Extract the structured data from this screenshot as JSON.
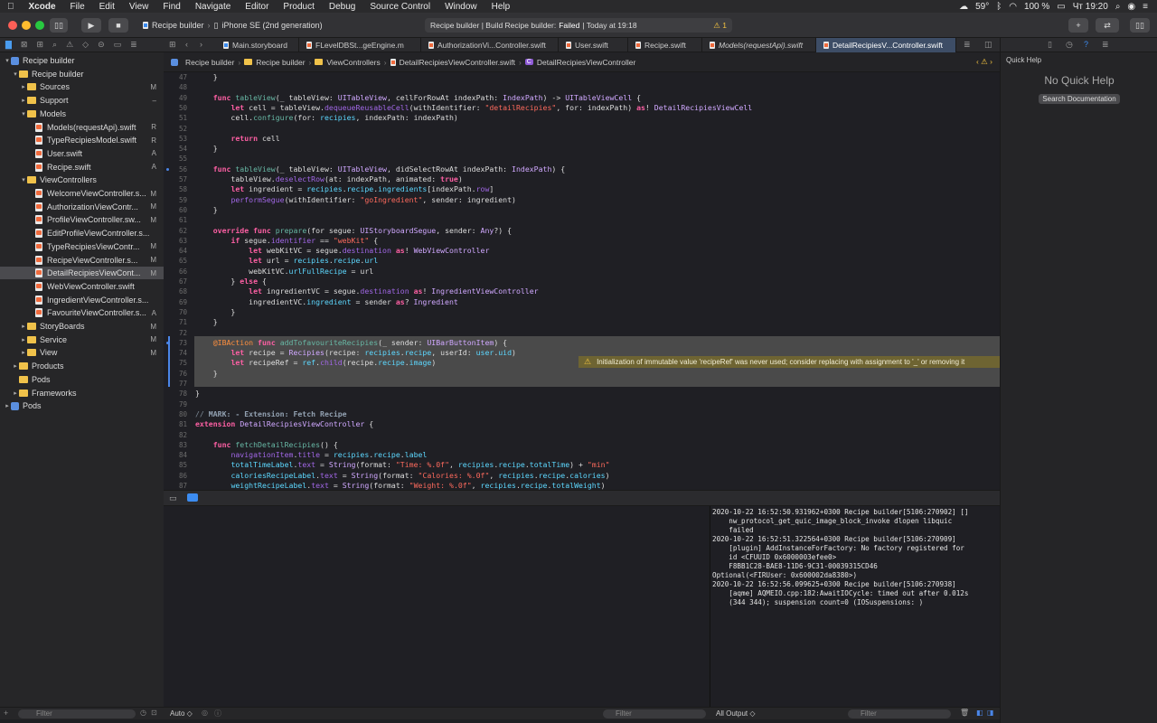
{
  "menubar": {
    "app": "Xcode",
    "items": [
      "File",
      "Edit",
      "View",
      "Find",
      "Navigate",
      "Editor",
      "Product",
      "Debug",
      "Source Control",
      "Window",
      "Help"
    ],
    "status": {
      "temperature": "59°",
      "battery": "100 %",
      "clock": "Чт 19:20"
    }
  },
  "toolbar": {
    "scheme": "Recipe builder",
    "device": "iPhone SE (2nd generation)",
    "status_prefix": "Recipe builder | Build Recipe builder:",
    "status_result": "Failed",
    "status_time": "| Today at 19:18",
    "warnings": "⚠ 1"
  },
  "navigator": {
    "filter_placeholder": "Filter",
    "items": [
      {
        "label": "Recipe builder",
        "indent": 0,
        "kind": "project",
        "disclosure": "▾",
        "badge": ""
      },
      {
        "label": "Recipe builder",
        "indent": 1,
        "kind": "folder",
        "disclosure": "▾",
        "badge": ""
      },
      {
        "label": "Sources",
        "indent": 2,
        "kind": "folder",
        "disclosure": "▸",
        "badge": "M"
      },
      {
        "label": "Support",
        "indent": 2,
        "kind": "folder",
        "disclosure": "▸",
        "badge": "–"
      },
      {
        "label": "Models",
        "indent": 2,
        "kind": "folder",
        "disclosure": "▾",
        "badge": ""
      },
      {
        "label": "Models(requestApi).swift",
        "indent": 3,
        "kind": "swift",
        "disclosure": "",
        "badge": "R"
      },
      {
        "label": "TypeRecipiesModel.swift",
        "indent": 3,
        "kind": "swift",
        "disclosure": "",
        "badge": "R"
      },
      {
        "label": "User.swift",
        "indent": 3,
        "kind": "swift",
        "disclosure": "",
        "badge": "A"
      },
      {
        "label": "Recipe.swift",
        "indent": 3,
        "kind": "swift",
        "disclosure": "",
        "badge": "A"
      },
      {
        "label": "ViewControllers",
        "indent": 2,
        "kind": "folder",
        "disclosure": "▾",
        "badge": ""
      },
      {
        "label": "WelcomeViewController.s...",
        "indent": 3,
        "kind": "swift",
        "disclosure": "",
        "badge": "M"
      },
      {
        "label": "AuthorizationViewContr...",
        "indent": 3,
        "kind": "swift",
        "disclosure": "",
        "badge": "M"
      },
      {
        "label": "ProfileViewController.sw...",
        "indent": 3,
        "kind": "swift",
        "disclosure": "",
        "badge": "M"
      },
      {
        "label": "EditProfileViewController.s...",
        "indent": 3,
        "kind": "swift",
        "disclosure": "",
        "badge": ""
      },
      {
        "label": "TypeRecipiesViewContr...",
        "indent": 3,
        "kind": "swift",
        "disclosure": "",
        "badge": "M"
      },
      {
        "label": "RecipeViewController.s...",
        "indent": 3,
        "kind": "swift",
        "disclosure": "",
        "badge": "M"
      },
      {
        "label": "DetailRecipiesViewCont...",
        "indent": 3,
        "kind": "swift",
        "disclosure": "",
        "badge": "M",
        "selected": true
      },
      {
        "label": "WebViewController.swift",
        "indent": 3,
        "kind": "swift",
        "disclosure": "",
        "badge": ""
      },
      {
        "label": "IngredientViewController.s...",
        "indent": 3,
        "kind": "swift",
        "disclosure": "",
        "badge": ""
      },
      {
        "label": "FavouriteViewController.s...",
        "indent": 3,
        "kind": "swift",
        "disclosure": "",
        "badge": "A"
      },
      {
        "label": "StoryBoards",
        "indent": 2,
        "kind": "folder",
        "disclosure": "▸",
        "badge": "M"
      },
      {
        "label": "Service",
        "indent": 2,
        "kind": "folder",
        "disclosure": "▸",
        "badge": "M"
      },
      {
        "label": "View",
        "indent": 2,
        "kind": "folder",
        "disclosure": "▸",
        "badge": "M"
      },
      {
        "label": "Products",
        "indent": 1,
        "kind": "folder",
        "disclosure": "▸",
        "badge": ""
      },
      {
        "label": "Pods",
        "indent": 1,
        "kind": "folder",
        "disclosure": "",
        "badge": ""
      },
      {
        "label": "Frameworks",
        "indent": 1,
        "kind": "folder",
        "disclosure": "▸",
        "badge": ""
      },
      {
        "label": "Pods",
        "indent": 0,
        "kind": "project",
        "disclosure": "▸",
        "badge": ""
      }
    ]
  },
  "tabs": [
    {
      "label": "Main.storyboard",
      "kind": "storyboard"
    },
    {
      "label": "FLevelDBSt...geEngine.m",
      "kind": "objc"
    },
    {
      "label": "AuthorizationVi...Controller.swift",
      "kind": "swift"
    },
    {
      "label": "User.swift",
      "kind": "swift"
    },
    {
      "label": "Recipe.swift",
      "kind": "swift"
    },
    {
      "label": "Models(requestApi).swift",
      "kind": "swift"
    },
    {
      "label": "DetailRecipiesV...Controller.swift",
      "kind": "swift",
      "active": true
    }
  ],
  "jumpbar": [
    "Recipe builder",
    "Recipe builder",
    "ViewControllers",
    "DetailRecipiesViewController.swift",
    "DetailRecipiesViewController"
  ],
  "editor": {
    "warning": "Initialization of immutable value 'recipeRef' was never used; consider replacing with assignment to '_' or removing it"
  },
  "console": {
    "lines": [
      "2020-10-22 16:52:50.931962+0300 Recipe builder[5106:270902] []",
      "    nw_protocol_get_quic_image_block_invoke dlopen libquic",
      "    failed",
      "2020-10-22 16:52:51.322564+0300 Recipe builder[5106:270909]",
      "    [plugin] AddInstanceForFactory: No factory registered for",
      "    id <CFUUID 0x6000003efee0>",
      "    F8BB1C28-BAE8-11D6-9C31-00039315CD46",
      "Optional(<FIRUser: 0x600002da8380>)",
      "2020-10-22 16:52:56.099625+0300 Recipe builder[5106:270938]",
      "    [aqme] AQMEIO.cpp:182:AwaitIOCycle: timed out after 0.012s",
      "    (344 344); suspension count=0 (IOSuspensions: )"
    ]
  },
  "bottom": {
    "auto_label": "Auto ◇",
    "var_filter": "Filter",
    "output_label": "All Output ◇",
    "console_filter": "Filter"
  },
  "inspector": {
    "title": "Quick Help",
    "empty": "No Quick Help",
    "button": "Search Documentation"
  }
}
